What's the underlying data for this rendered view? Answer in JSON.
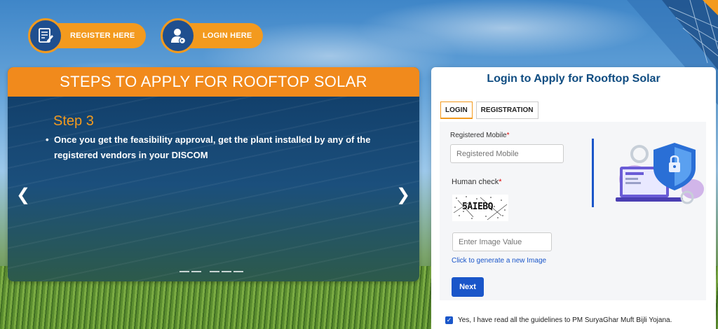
{
  "top_actions": {
    "register_label": "REGISTER HERE",
    "register_icon": "form-icon",
    "login_label": "LOGIN HERE",
    "login_icon": "user-login-icon"
  },
  "steps": {
    "header": "STEPS TO APPLY FOR ROOFTOP SOLAR",
    "current_step_title": "Step 3",
    "bullet": "•",
    "current_step_text": "Once you get the feasibility approval, get the plant installed by any of the registered vendors in your DISCOM",
    "prev_arrow": "❮",
    "next_arrow": "❯",
    "slide_count": 6
  },
  "login": {
    "title": "Login to Apply for Rooftop Solar",
    "tabs": [
      {
        "label": "LOGIN",
        "active": true
      },
      {
        "label": "REGISTRATION",
        "active": false
      }
    ],
    "mobile_label": "Registered Mobile",
    "required_mark": "*",
    "mobile_placeholder": "Registered Mobile",
    "human_check_label": "Human check",
    "captcha_text": "5AIEBQ",
    "captcha_placeholder": "Enter Image Value",
    "generate_link": "Click to generate a new Image",
    "next_button": "Next",
    "illustration_icon": "security-shield-laptop-icon",
    "agree_checked": true,
    "checkbox_mark": "✓",
    "agree_text": "Yes, I have read all the guidelines to PM SuryaGhar Muft Bijli Yojana."
  },
  "colors": {
    "accent_orange": "#f39a1e",
    "navy": "#1f4f8f",
    "link_blue": "#1a56c9",
    "title_blue": "#0f4c81"
  }
}
